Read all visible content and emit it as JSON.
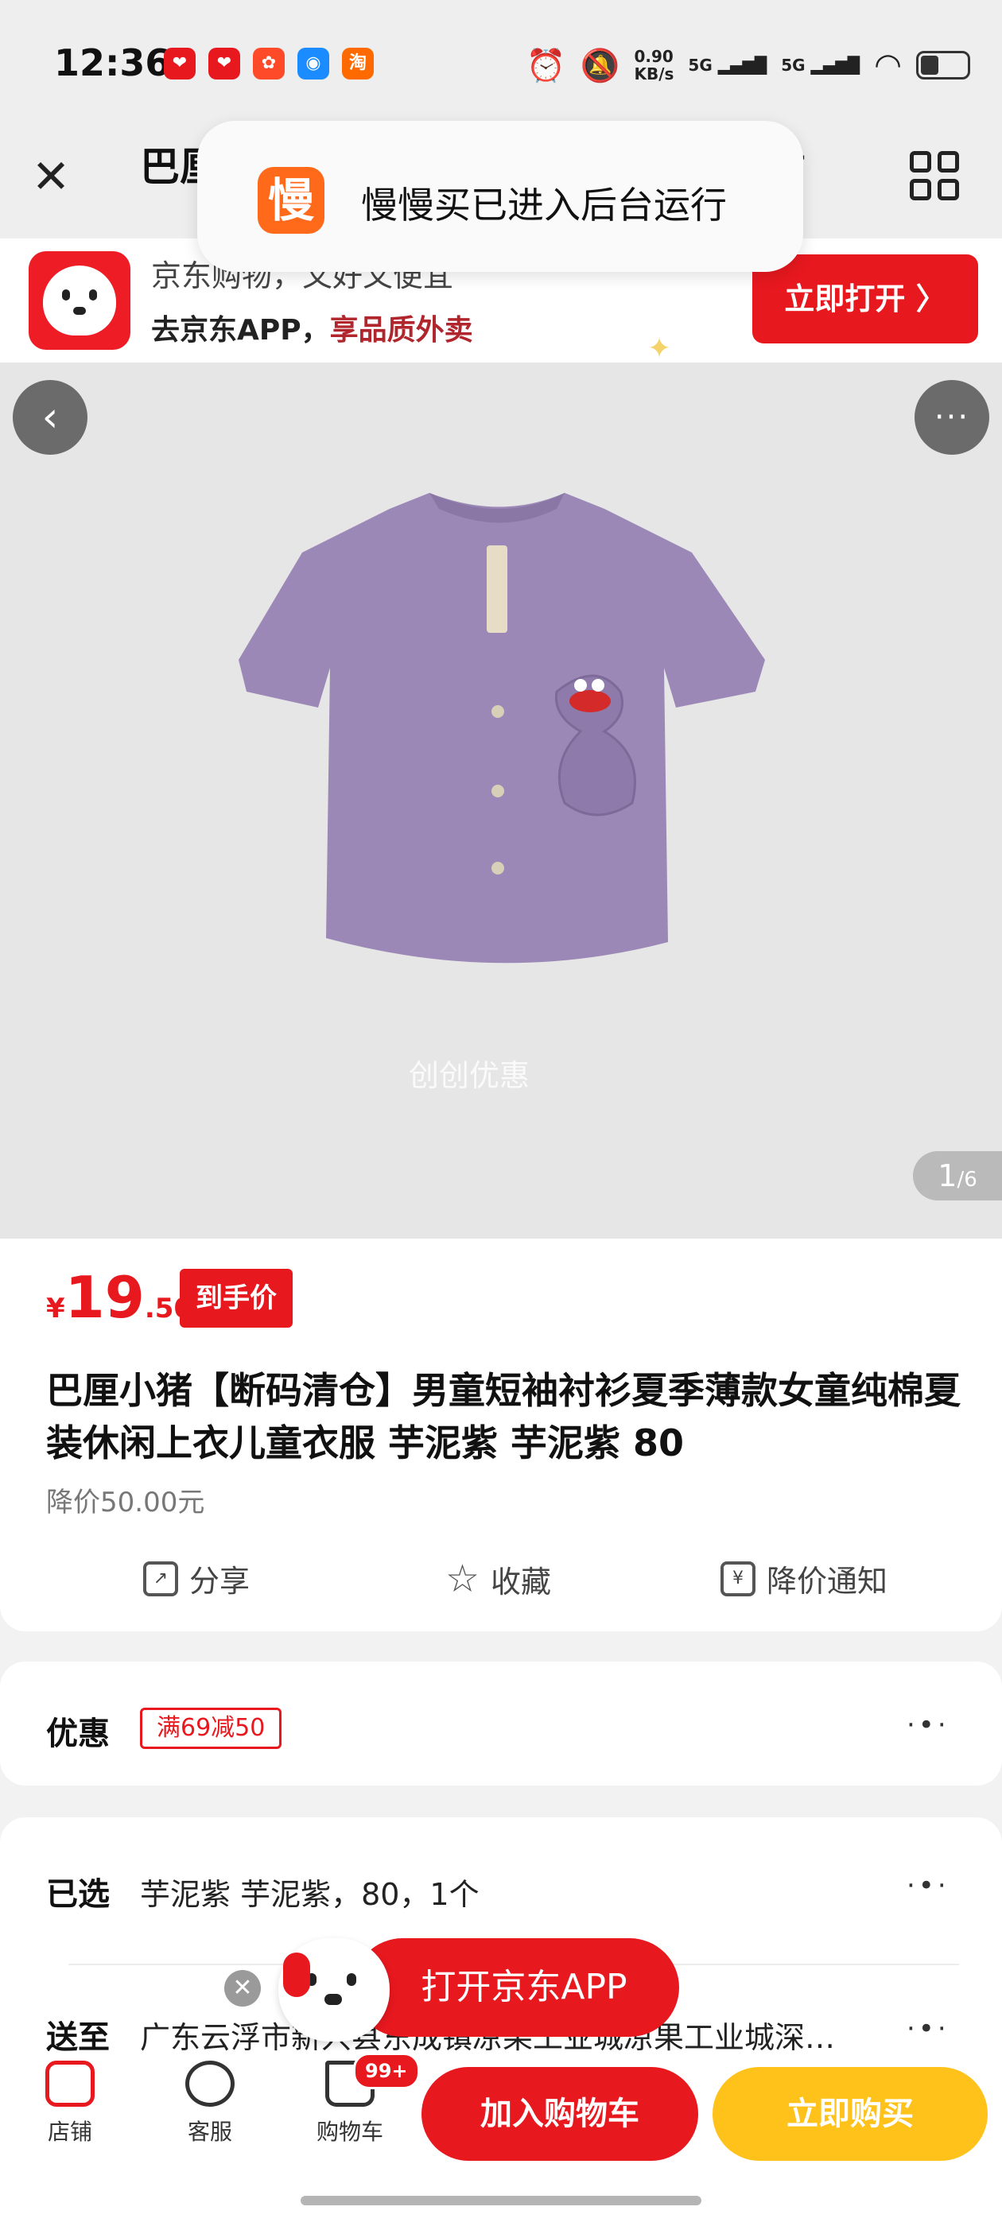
{
  "status": {
    "time": "12:36",
    "speed": "0.90\nKB/s",
    "net1": "5G",
    "net2": "5G"
  },
  "nav": {
    "title": "巴厘"
  },
  "toast": {
    "icon_char": "慢",
    "text": "慢慢买已进入后台运行"
  },
  "banner": {
    "line1": "京东购物，又好又便宜",
    "line2_prefix": "去京东APP，",
    "line2_highlight": "享品质外卖",
    "open_label": "立即打开 〉"
  },
  "hero": {
    "watermark": "创创优惠",
    "pager_current": "1",
    "pager_total": "/6"
  },
  "product": {
    "price_symbol": "¥",
    "price_int": "19",
    "price_dec": ".50",
    "price_badge": "到手价",
    "title": "巴厘小猪【断码清仓】男童短袖衬衫夏季薄款女童纯棉夏装休闲上衣儿童衣服 芋泥紫 芋泥紫 80",
    "price_drop": "降价50.00元",
    "actions": {
      "share": "分享",
      "favorite": "收藏",
      "price_alert": "降价通知"
    }
  },
  "promo": {
    "label": "优惠",
    "coupon": "满69减50"
  },
  "selection": {
    "selected_label": "已选",
    "selected_value": "芋泥紫 芋泥紫，80，1个",
    "ship_label": "送至",
    "ship_value": "广东云浮市新兴县东成镇凉果工业城凉果工业城深…"
  },
  "float": {
    "label": "打开京东APP",
    "close": "✕"
  },
  "bottom": {
    "store": "店铺",
    "service": "客服",
    "cart": "购物车",
    "cart_badge": "99+",
    "add_to_cart": "加入购物车",
    "buy_now": "立即购买"
  },
  "colors": {
    "accent": "#e8181f",
    "buy": "#ffc21a",
    "toast_icon": "#ff6a1a",
    "shirt": "#9b88b6"
  }
}
